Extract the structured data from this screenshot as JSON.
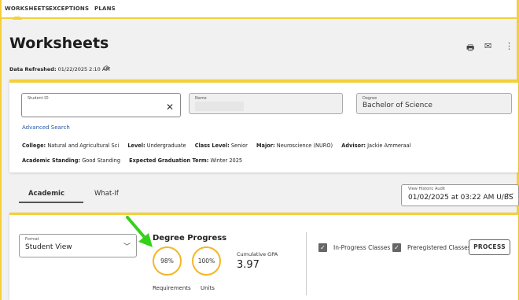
{
  "nav": {
    "tabs": [
      "WORKSHEETS",
      "EXCEPTIONS",
      "PLANS"
    ]
  },
  "page": {
    "title": "Worksheets",
    "refreshed_label": "Data Refreshed:",
    "refreshed_value": "01/22/2025 2:10 AM"
  },
  "search": {
    "student_id_label": "Student ID",
    "student_id_value": "",
    "name_label": "Name",
    "degree_label": "Degree",
    "degree_value": "Bachelor of Science",
    "advanced_search": "Advanced Search"
  },
  "student_info": {
    "college_label": "College:",
    "college": "Natural and Agricultural Sci",
    "level_label": "Level:",
    "level": "Undergraduate",
    "class_level_label": "Class Level:",
    "class_level": "Senior",
    "major_label": "Major:",
    "major": "Neuroscience (NURO)",
    "advisor_label": "Advisor:",
    "advisor": "Jackie Ammeraal",
    "standing_label": "Academic Standing:",
    "standing": "Good Standing",
    "grad_label": "Expected Graduation Term:",
    "grad": "Winter 2025"
  },
  "audit_tabs": [
    "Academic",
    "What-If"
  ],
  "historic": {
    "label": "View Historic Audit",
    "value": "01/02/2025 at 03:22 AM U/BS"
  },
  "format": {
    "label": "Format",
    "value": "Student View"
  },
  "progress": {
    "title": "Degree Progress",
    "requirements_pct": "98%",
    "units_pct": "100%",
    "requirements_label": "Requirements",
    "units_label": "Units",
    "gpa_label": "Cumulative GPA",
    "gpa_value": "3.97"
  },
  "options": {
    "in_progress_label": "In-Progress Classes",
    "preregistered_label": "Preregistered Classes",
    "process_label": "PROCESS"
  },
  "colors": {
    "accent": "#f4cf3a",
    "ring": "#f4b624",
    "arrow": "#35d11a"
  }
}
